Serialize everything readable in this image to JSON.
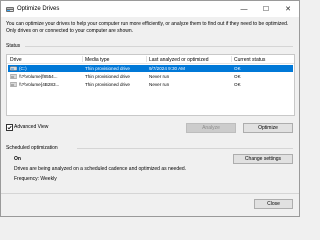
{
  "window": {
    "title": "Optimize Drives",
    "minimize_glyph": "—",
    "maximize_glyph": "☐",
    "close_glyph": "✕"
  },
  "description": "You can optimize your drives to help your computer run more efficiently, or analyze them to find out if they need to be optimized. Only drives on or connected to your computer are shown.",
  "status": {
    "label": "Status",
    "columns": [
      "Drive",
      "Media type",
      "Last analyzed or optimized",
      "Current status"
    ],
    "rows": [
      {
        "drive": "(C:)",
        "media_type": "Thin provisioned drive",
        "last": "9/7/2024 9:30 AM",
        "status": "OK",
        "selected": true
      },
      {
        "drive": "\\\\?\\Volume{f8554...",
        "media_type": "Thin provisioned drive",
        "last": "Never run",
        "status": "OK",
        "selected": false
      },
      {
        "drive": "\\\\?\\Volume{4B283...",
        "media_type": "Thin provisioned drive",
        "last": "Never run",
        "status": "OK",
        "selected": false
      }
    ]
  },
  "advanced_view": {
    "label": "Advanced View",
    "checked": true
  },
  "buttons": {
    "analyze": "Analyze",
    "optimize": "Optimize",
    "change_settings": "Change settings",
    "close": "Close"
  },
  "scheduled": {
    "section_label": "Scheduled optimization",
    "state": "On",
    "description": "Drives are being analyzed on a scheduled cadence and optimized as needed.",
    "frequency": "Frequency: Weekly"
  },
  "colors": {
    "selection": "#0078d7",
    "window_bg": "#f0f0f0"
  }
}
